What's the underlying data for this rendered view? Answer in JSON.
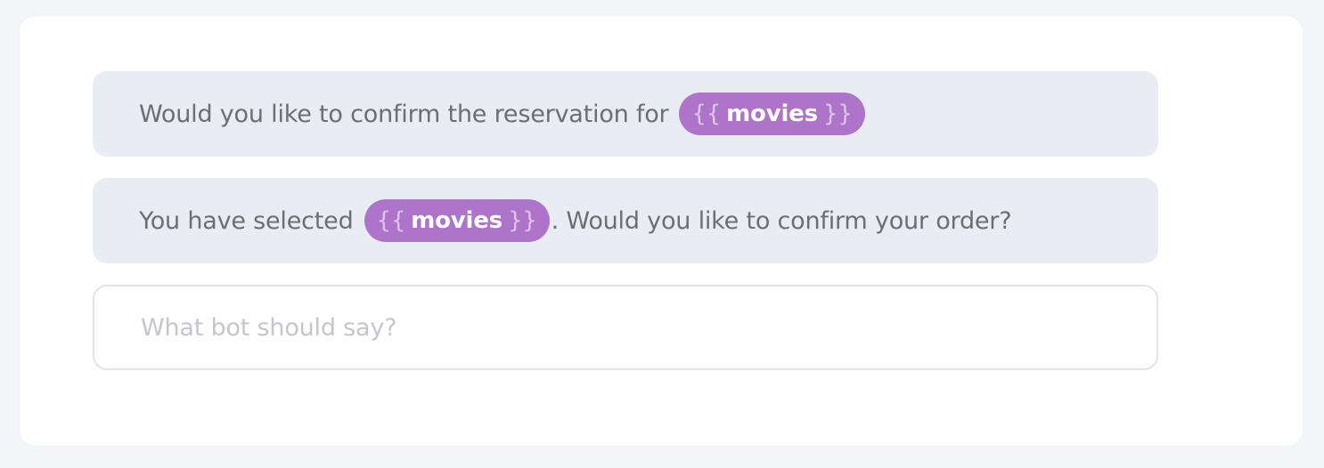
{
  "responses": [
    {
      "before": "Would you like to confirm the reservation for",
      "variable": {
        "open": "{{",
        "name": "movies",
        "close": "}}"
      },
      "after": ""
    },
    {
      "before": "You have selected",
      "variable": {
        "open": "{{",
        "name": "movies",
        "close": "}}"
      },
      "after": ". Would you like to confirm your order?"
    }
  ],
  "input": {
    "placeholder": "What bot should say?",
    "value": ""
  },
  "colors": {
    "page_bg": "#f4f5f8",
    "card_bg": "#ffffff",
    "response_bg": "#e9ecf3",
    "variable_chip": "#ad74c9",
    "text": "#6d6d73",
    "placeholder": "#c5c6cd"
  }
}
